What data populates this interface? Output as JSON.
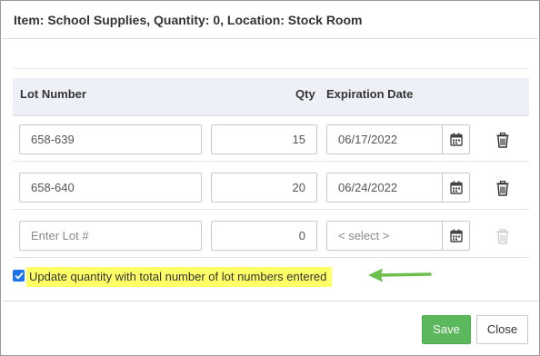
{
  "header": {
    "title": "Item: School Supplies, Quantity: 0, Location: Stock Room"
  },
  "table": {
    "columns": {
      "lot_number": "Lot Number",
      "qty": "Qty",
      "expiration_date": "Expiration Date"
    },
    "rows": [
      {
        "lot": "658-639",
        "qty": "15",
        "date": "06/17/2022",
        "delete_enabled": true
      },
      {
        "lot": "658-640",
        "qty": "20",
        "date": "06/24/2022",
        "delete_enabled": true
      }
    ],
    "new_row": {
      "lot_placeholder": "Enter Lot #",
      "qty": "0",
      "date_placeholder": "< select >",
      "delete_enabled": false
    }
  },
  "options": {
    "update_quantity_checked": true,
    "update_quantity_label": "Update quantity with total number of lot numbers entered"
  },
  "icons": {
    "calendar": "calendar-icon",
    "delete": "trash-icon",
    "annotation_arrow": "arrow-left-icon"
  },
  "colors": {
    "highlight": "#ffff66",
    "arrow": "#6cbf4b",
    "save_button": "#5cb85c",
    "checkbox": "#1a73e8"
  },
  "footer": {
    "save_label": "Save",
    "close_label": "Close"
  }
}
